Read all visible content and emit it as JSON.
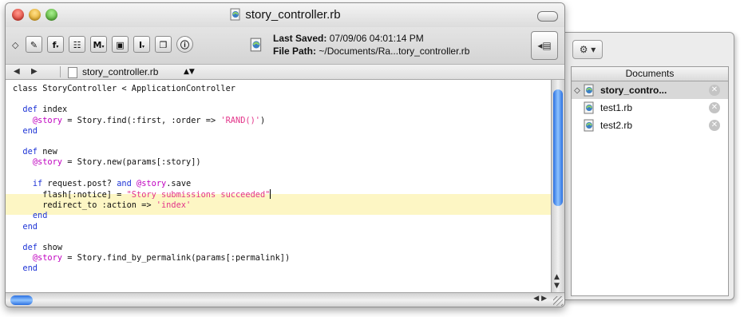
{
  "window": {
    "title": "story_controller.rb"
  },
  "toolbar": {
    "buttons": [
      "f",
      "M",
      "I"
    ],
    "info": {
      "last_saved_label": "Last Saved:",
      "last_saved_value": "07/09/06 04:01:14 PM",
      "file_path_label": "File Path:",
      "file_path_value": "~/Documents/Ra...tory_controller.rb"
    }
  },
  "navbar": {
    "filename": "story_controller.rb"
  },
  "code": {
    "lines": [
      "class StoryController < ApplicationController",
      "",
      "  def index",
      "    @story = Story.find(:first, :order => 'RAND()')",
      "  end",
      "",
      "  def new",
      "    @story = Story.new(params[:story])",
      "",
      "    if request.post? and @story.save",
      "      flash[:notice] = \"Story submissions succeeded\"",
      "      redirect_to :action => 'index'",
      "    end",
      "  end",
      "",
      "  def show",
      "    @story = Story.find_by_permalink(params[:permalink])",
      "  end"
    ]
  },
  "drawer": {
    "header": "Documents",
    "items": [
      {
        "label": "story_contro...",
        "selected": true
      },
      {
        "label": "test1.rb",
        "selected": false
      },
      {
        "label": "test2.rb",
        "selected": false
      }
    ]
  },
  "colors": {
    "keyword": "#1f35d6",
    "ivar": "#c000c0",
    "string": "#e3358a",
    "highlight": "#fdf6c4"
  }
}
